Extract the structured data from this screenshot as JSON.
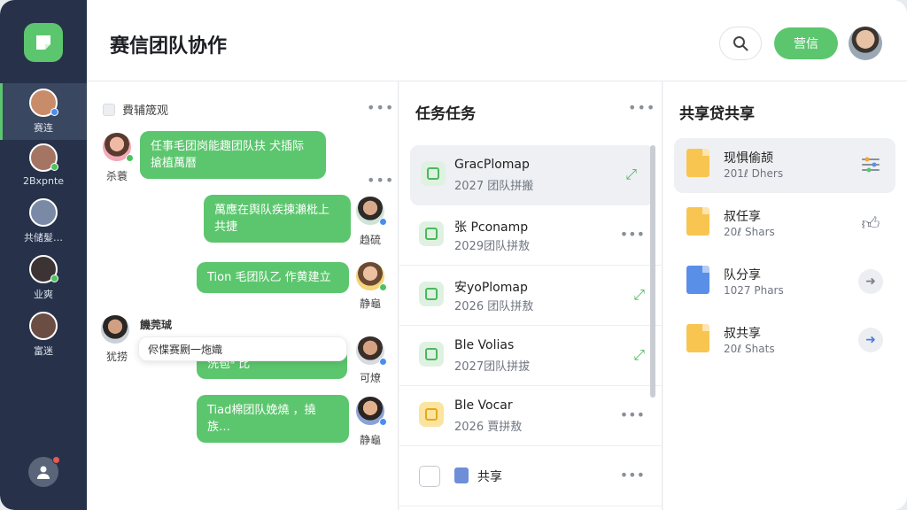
{
  "header": {
    "title": "赛信团队协作",
    "primary_button": "营信"
  },
  "sidebar": {
    "items": [
      {
        "label": "赛连",
        "color": "#c98c6a"
      },
      {
        "label": "2Bxpnte",
        "color": "#a57563"
      },
      {
        "label": "共储髮…",
        "color": "#7a8aa6"
      },
      {
        "label": "业爽",
        "color": "#3c3434"
      },
      {
        "label": "富迷",
        "color": "#6b4d44"
      }
    ]
  },
  "chat": {
    "header": "費辅筬观",
    "messages": [
      {
        "text": "任事毛团岗能趣团队扶 犬插际 搶植萬曆",
        "name": "杀蓑"
      },
      {
        "text": "萬應在舆队疾揀瀨枇上 共捷",
        "name": "趋硫"
      },
      {
        "text": "Tion 毛团队乙 作黄建立",
        "name": "静龜"
      },
      {
        "text": "洗苞ᵃ 比",
        "name": "可燎"
      },
      {
        "text": "Tiad棉团队娩燒 ，撓族…",
        "name": "静龜"
      }
    ],
    "popup": {
      "author": "饑莞珹",
      "text": "侭惵赛劂一炧嬂",
      "name": "犹捞"
    }
  },
  "tasks": {
    "title": "任务任务",
    "items": [
      {
        "name": "GracPlomap",
        "meta": "2027 团队拼搬"
      },
      {
        "name": "张 Pconamp",
        "meta": "2029团队拼敖"
      },
      {
        "name": "安yoPlomap",
        "meta": "2026 团队拼敖"
      },
      {
        "name": "Ble Volias",
        "meta": "2027团队拼拔"
      },
      {
        "name": "Ble Vocar",
        "meta": "2026 賈拼敖"
      },
      {
        "name": "共享",
        "meta": ""
      }
    ]
  },
  "shares": {
    "title": "共享贷共享",
    "items": [
      {
        "name": "现惧偷颉",
        "meta": "201ℓ Dhers"
      },
      {
        "name": "叔任享",
        "meta": "20ℓ Shars"
      },
      {
        "name": "队分享",
        "meta": "1027 Phars"
      },
      {
        "name": "叔共享",
        "meta": "20ℓ Shats"
      }
    ]
  },
  "colors": {
    "accent": "#5cc66e",
    "sidebar": "#27324a"
  },
  "icons": {
    "logo": "app-logo-icon",
    "search": "search-icon",
    "more": "more-dots-icon",
    "link": "link-arrow-icon",
    "like": "thumbs-up-icon",
    "arrow": "arrow-right-icon",
    "settings": "sliders-icon"
  }
}
